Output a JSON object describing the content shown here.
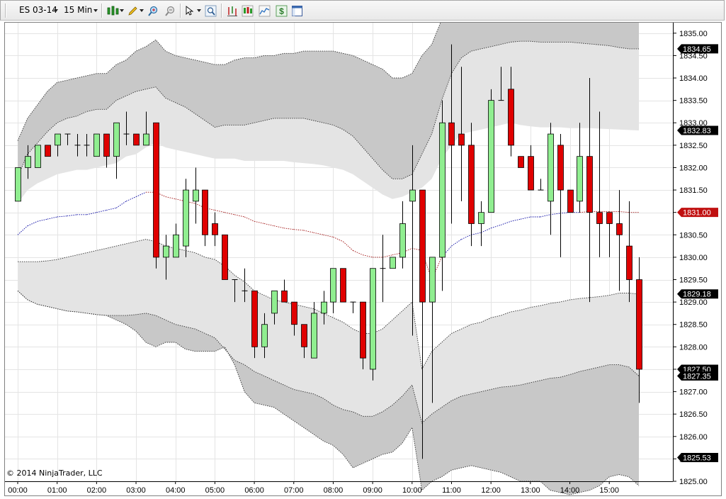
{
  "toolbar": {
    "instrument": "ES 03-14",
    "interval": "15 Min",
    "icons": [
      "chart-style-icon",
      "drawing-pencil-icon",
      "zoom-in-icon",
      "zoom-out-icon",
      "cursor-select-icon",
      "magnifier-icon",
      "bar-chart-icon",
      "candlestick-icon",
      "area-chart-icon",
      "dollar-icon",
      "window-icon"
    ]
  },
  "copyright": "© 2014 NinjaTrader, LLC",
  "colors": {
    "up": "#90ee90",
    "down": "#e00000",
    "outer_band": "#c8c8c8",
    "inner_band": "#e4e4e4",
    "upper_mid_line": "#0000a0",
    "lower_mid_line": "#a01010",
    "grid": "#e4e4e4"
  },
  "chart_data": {
    "type": "candlestick",
    "title": "",
    "xlabel": "",
    "ylabel": "",
    "ylim": [
      1825.0,
      1835.25
    ],
    "y_ticks": [
      "1825.00",
      "1825.50",
      "1826.00",
      "1826.50",
      "1827.00",
      "1827.50",
      "1828.00",
      "1828.50",
      "1829.00",
      "1829.50",
      "1830.00",
      "1830.50",
      "1831.00",
      "1831.50",
      "1832.00",
      "1832.50",
      "1833.00",
      "1833.50",
      "1834.00",
      "1834.50",
      "1835.00"
    ],
    "x_tick_labels": [
      "00:00",
      "01:00",
      "02:00",
      "03:00",
      "04:00",
      "05:00",
      "06:00",
      "07:00",
      "08:00",
      "09:00",
      "10:00",
      "11:00",
      "12:00",
      "13:00",
      "14:00",
      "15:00"
    ],
    "price_markers": [
      {
        "label": "1834.65",
        "value": 1834.65,
        "style": "dark"
      },
      {
        "label": "1832.83",
        "value": 1832.83,
        "style": "dark"
      },
      {
        "label": "1831.00",
        "value": 1831.0,
        "style": "red"
      },
      {
        "label": "1829.18",
        "value": 1829.18,
        "style": "dark"
      },
      {
        "label": "1827.50",
        "value": 1827.5,
        "style": "dark"
      },
      {
        "label": "1827.35",
        "value": 1827.35,
        "style": "dark"
      },
      {
        "label": "1825.53",
        "value": 1825.53,
        "style": "dark"
      }
    ],
    "candles": [
      {
        "o": 1831.25,
        "h": 1832.0,
        "l": 1831.25,
        "c": 1832.0
      },
      {
        "o": 1832.0,
        "h": 1832.5,
        "l": 1831.75,
        "c": 1832.25
      },
      {
        "o": 1832.0,
        "h": 1832.5,
        "l": 1832.0,
        "c": 1832.5
      },
      {
        "o": 1832.5,
        "h": 1832.5,
        "l": 1832.25,
        "c": 1832.25
      },
      {
        "o": 1832.5,
        "h": 1832.75,
        "l": 1832.25,
        "c": 1832.75
      },
      {
        "o": 1832.75,
        "h": 1832.75,
        "l": 1832.5,
        "c": 1832.75
      },
      {
        "o": 1832.5,
        "h": 1832.75,
        "l": 1832.25,
        "c": 1832.5
      },
      {
        "o": 1832.5,
        "h": 1832.75,
        "l": 1832.25,
        "c": 1832.5
      },
      {
        "o": 1832.25,
        "h": 1832.75,
        "l": 1832.25,
        "c": 1832.75
      },
      {
        "o": 1832.75,
        "h": 1832.75,
        "l": 1832.0,
        "c": 1832.25
      },
      {
        "o": 1832.25,
        "h": 1833.0,
        "l": 1831.75,
        "c": 1833.0
      },
      {
        "o": 1832.75,
        "h": 1833.25,
        "l": 1832.5,
        "c": 1832.75
      },
      {
        "o": 1832.75,
        "h": 1832.75,
        "l": 1832.5,
        "c": 1832.5
      },
      {
        "o": 1832.5,
        "h": 1833.25,
        "l": 1832.5,
        "c": 1832.75
      },
      {
        "o": 1833.0,
        "h": 1833.0,
        "l": 1829.75,
        "c": 1830.0
      },
      {
        "o": 1830.0,
        "h": 1830.5,
        "l": 1829.5,
        "c": 1830.25
      },
      {
        "o": 1830.0,
        "h": 1830.75,
        "l": 1830.0,
        "c": 1830.5
      },
      {
        "o": 1830.25,
        "h": 1831.75,
        "l": 1830.0,
        "c": 1831.5
      },
      {
        "o": 1831.25,
        "h": 1832.0,
        "l": 1830.75,
        "c": 1831.5
      },
      {
        "o": 1831.5,
        "h": 1831.5,
        "l": 1830.25,
        "c": 1830.5
      },
      {
        "o": 1830.75,
        "h": 1831.0,
        "l": 1830.25,
        "c": 1830.5
      },
      {
        "o": 1830.5,
        "h": 1830.5,
        "l": 1829.5,
        "c": 1829.5
      },
      {
        "o": 1829.5,
        "h": 1829.5,
        "l": 1829.0,
        "c": 1829.5
      },
      {
        "o": 1829.25,
        "h": 1829.75,
        "l": 1829.0,
        "c": 1829.25
      },
      {
        "o": 1829.25,
        "h": 1829.25,
        "l": 1827.75,
        "c": 1828.0
      },
      {
        "o": 1828.0,
        "h": 1828.75,
        "l": 1827.75,
        "c": 1828.5
      },
      {
        "o": 1828.75,
        "h": 1829.25,
        "l": 1828.5,
        "c": 1829.25
      },
      {
        "o": 1829.25,
        "h": 1829.5,
        "l": 1829.0,
        "c": 1829.0
      },
      {
        "o": 1829.0,
        "h": 1829.0,
        "l": 1828.25,
        "c": 1828.5
      },
      {
        "o": 1828.5,
        "h": 1828.5,
        "l": 1827.75,
        "c": 1828.0
      },
      {
        "o": 1827.75,
        "h": 1829.0,
        "l": 1827.75,
        "c": 1828.75
      },
      {
        "o": 1828.75,
        "h": 1829.25,
        "l": 1828.5,
        "c": 1829.0
      },
      {
        "o": 1829.0,
        "h": 1829.75,
        "l": 1828.75,
        "c": 1829.75
      },
      {
        "o": 1829.75,
        "h": 1829.75,
        "l": 1829.0,
        "c": 1829.0
      },
      {
        "o": 1829.0,
        "h": 1829.0,
        "l": 1828.75,
        "c": 1829.0
      },
      {
        "o": 1829.0,
        "h": 1829.0,
        "l": 1827.5,
        "c": 1827.75
      },
      {
        "o": 1827.5,
        "h": 1829.75,
        "l": 1827.25,
        "c": 1829.75
      },
      {
        "o": 1829.75,
        "h": 1830.5,
        "l": 1829.0,
        "c": 1829.75
      },
      {
        "o": 1829.75,
        "h": 1830.0,
        "l": 1829.75,
        "c": 1830.0
      },
      {
        "o": 1830.0,
        "h": 1831.25,
        "l": 1829.75,
        "c": 1830.75
      },
      {
        "o": 1831.25,
        "h": 1832.5,
        "l": 1828.25,
        "c": 1831.5
      },
      {
        "o": 1831.5,
        "h": 1831.5,
        "l": 1825.5,
        "c": 1829.0
      },
      {
        "o": 1829.0,
        "h": 1830.0,
        "l": 1826.75,
        "c": 1830.0
      },
      {
        "o": 1830.0,
        "h": 1833.5,
        "l": 1829.25,
        "c": 1833.0
      },
      {
        "o": 1833.0,
        "h": 1834.75,
        "l": 1830.75,
        "c": 1832.5
      },
      {
        "o": 1832.75,
        "h": 1834.25,
        "l": 1831.25,
        "c": 1832.5
      },
      {
        "o": 1832.5,
        "h": 1833.0,
        "l": 1830.25,
        "c": 1830.75
      },
      {
        "o": 1830.75,
        "h": 1831.25,
        "l": 1830.25,
        "c": 1831.0
      },
      {
        "o": 1831.0,
        "h": 1833.75,
        "l": 1831.0,
        "c": 1833.5
      },
      {
        "o": 1833.5,
        "h": 1834.25,
        "l": 1833.5,
        "c": 1833.5
      },
      {
        "o": 1833.75,
        "h": 1834.25,
        "l": 1832.25,
        "c": 1832.5
      },
      {
        "o": 1832.25,
        "h": 1832.25,
        "l": 1832.0,
        "c": 1832.0
      },
      {
        "o": 1832.25,
        "h": 1832.5,
        "l": 1831.5,
        "c": 1831.5
      },
      {
        "o": 1831.5,
        "h": 1831.75,
        "l": 1831.5,
        "c": 1831.5
      },
      {
        "o": 1831.25,
        "h": 1833.0,
        "l": 1830.5,
        "c": 1832.75
      },
      {
        "o": 1832.5,
        "h": 1832.75,
        "l": 1830.0,
        "c": 1831.5
      },
      {
        "o": 1831.5,
        "h": 1831.5,
        "l": 1831.0,
        "c": 1831.0
      },
      {
        "o": 1831.25,
        "h": 1833.0,
        "l": 1831.0,
        "c": 1832.25
      },
      {
        "o": 1832.25,
        "h": 1834.0,
        "l": 1829.0,
        "c": 1831.0
      },
      {
        "o": 1831.0,
        "h": 1833.25,
        "l": 1830.0,
        "c": 1830.75
      },
      {
        "o": 1831.0,
        "h": 1831.0,
        "l": 1830.0,
        "c": 1830.75
      },
      {
        "o": 1830.75,
        "h": 1831.5,
        "l": 1829.25,
        "c": 1830.5
      },
      {
        "o": 1830.25,
        "h": 1831.25,
        "l": 1829.0,
        "c": 1829.5
      },
      {
        "o": 1829.5,
        "h": 1830.0,
        "l": 1826.75,
        "c": 1827.5
      }
    ],
    "bands": {
      "outer_upper": [
        1832.6,
        1833.1,
        1833.4,
        1833.7,
        1833.9,
        1833.95,
        1834.0,
        1834.05,
        1834.1,
        1834.1,
        1834.3,
        1834.4,
        1834.6,
        1834.7,
        1834.85,
        1834.6,
        1834.5,
        1834.45,
        1834.4,
        1834.35,
        1834.3,
        1834.3,
        1834.4,
        1834.45,
        1834.45,
        1834.5,
        1834.5,
        1834.55,
        1834.55,
        1834.6,
        1834.6,
        1834.6,
        1834.6,
        1834.55,
        1834.5,
        1834.4,
        1834.3,
        1834.2,
        1834.0,
        1834.0,
        1834.1,
        1834.5,
        1834.75,
        1835.3,
        1835.25,
        1835.25,
        1835.25,
        1835.25,
        1835.25,
        1835.25,
        1835.25,
        1835.25,
        1835.25,
        1835.25,
        1835.25,
        1835.25,
        1835.25,
        1835.25,
        1835.25,
        1835.25,
        1835.25,
        1835.25,
        1835.25,
        1835.25
      ],
      "inner_upper": [
        1831.8,
        1832.3,
        1832.55,
        1832.8,
        1833.0,
        1833.1,
        1833.15,
        1833.25,
        1833.3,
        1833.3,
        1833.5,
        1833.6,
        1833.7,
        1833.75,
        1833.8,
        1833.55,
        1833.45,
        1833.35,
        1833.2,
        1833.05,
        1832.9,
        1832.95,
        1832.95,
        1832.95,
        1833.0,
        1833.05,
        1833.1,
        1833.1,
        1833.1,
        1833.1,
        1833.05,
        1833.0,
        1832.95,
        1832.85,
        1832.7,
        1832.45,
        1832.2,
        1831.95,
        1831.75,
        1831.75,
        1831.85,
        1832.3,
        1832.75,
        1833.5,
        1834.1,
        1834.45,
        1834.6,
        1834.65,
        1834.7,
        1834.75,
        1834.8,
        1834.82,
        1834.82,
        1834.8,
        1834.8,
        1834.8,
        1834.8,
        1834.78,
        1834.76,
        1834.74,
        1834.72,
        1834.68,
        1834.65,
        1834.65
      ],
      "upper_mid": [
        1831.2,
        1831.5,
        1831.65,
        1831.75,
        1831.85,
        1831.9,
        1831.95,
        1831.95,
        1832.0,
        1832.05,
        1832.1,
        1832.25,
        1832.3,
        1832.45,
        1832.55,
        1832.45,
        1832.4,
        1832.35,
        1832.3,
        1832.25,
        1832.2,
        1832.2,
        1832.2,
        1832.15,
        1832.15,
        1832.15,
        1832.15,
        1832.15,
        1832.12,
        1832.1,
        1832.08,
        1832.05,
        1832.0,
        1831.95,
        1831.85,
        1831.7,
        1831.55,
        1831.4,
        1831.3,
        1831.35,
        1831.45,
        1831.55,
        1831.75,
        1832.2,
        1832.5,
        1832.75,
        1832.8,
        1832.85,
        1832.9,
        1832.95,
        1833.0,
        1832.95,
        1832.92,
        1832.9,
        1832.9,
        1832.9,
        1832.88,
        1832.88,
        1832.88,
        1832.87,
        1832.86,
        1832.85,
        1832.84,
        1832.83
      ],
      "mid": [
        1830.5,
        1830.7,
        1830.8,
        1830.85,
        1830.9,
        1830.92,
        1830.95,
        1830.95,
        1831.0,
        1831.05,
        1831.1,
        1831.25,
        1831.35,
        1831.45,
        1831.45,
        1831.35,
        1831.3,
        1831.25,
        1831.2,
        1831.1,
        1831.05,
        1831.0,
        1830.95,
        1830.9,
        1830.8,
        1830.75,
        1830.7,
        1830.65,
        1830.62,
        1830.6,
        1830.55,
        1830.5,
        1830.45,
        1830.35,
        1830.15,
        1830.05,
        1830.0,
        1830.0,
        1830.05,
        1830.1,
        1830.2,
        1830.15,
        1829.5,
        1830.0,
        1830.25,
        1830.4,
        1830.5,
        1830.55,
        1830.65,
        1830.72,
        1830.8,
        1830.85,
        1830.9,
        1830.9,
        1830.95,
        1830.98,
        1831.0,
        1831.0,
        1831.02,
        1831.02,
        1831.02,
        1831.02,
        1831.0,
        1831.0
      ],
      "lower_mid": [
        1829.9,
        1829.9,
        1829.9,
        1829.92,
        1829.95,
        1830.0,
        1830.05,
        1830.1,
        1830.15,
        1830.2,
        1830.25,
        1830.3,
        1830.35,
        1830.4,
        1830.35,
        1830.25,
        1830.2,
        1830.15,
        1830.1,
        1830.0,
        1829.95,
        1829.8,
        1829.6,
        1829.45,
        1829.25,
        1829.15,
        1829.05,
        1829.0,
        1828.95,
        1828.9,
        1828.85,
        1828.75,
        1828.65,
        1828.55,
        1828.4,
        1828.3,
        1828.3,
        1828.4,
        1828.6,
        1828.8,
        1829.0,
        1827.5,
        1827.9,
        1828.1,
        1828.3,
        1828.4,
        1828.5,
        1828.55,
        1828.65,
        1828.7,
        1828.78,
        1828.82,
        1828.88,
        1828.92,
        1828.97,
        1829.0,
        1829.05,
        1829.08,
        1829.1,
        1829.12,
        1829.15,
        1829.2,
        1829.2,
        1829.18
      ],
      "inner_lower": [
        1829.25,
        1829.05,
        1828.95,
        1828.9,
        1828.85,
        1828.8,
        1828.78,
        1828.75,
        1828.72,
        1828.7,
        1828.7,
        1828.7,
        1828.72,
        1828.75,
        1828.7,
        1828.6,
        1828.5,
        1828.45,
        1828.4,
        1828.3,
        1828.2,
        1827.95,
        1827.7,
        1827.6,
        1827.45,
        1827.35,
        1827.25,
        1827.15,
        1827.05,
        1827.0,
        1826.95,
        1826.85,
        1826.7,
        1826.6,
        1826.55,
        1826.45,
        1826.45,
        1826.55,
        1826.7,
        1826.9,
        1827.15,
        1826.3,
        1826.5,
        1826.65,
        1826.8,
        1826.9,
        1826.95,
        1827.0,
        1827.05,
        1827.1,
        1827.12,
        1827.15,
        1827.2,
        1827.25,
        1827.3,
        1827.32,
        1827.38,
        1827.45,
        1827.5,
        1827.55,
        1827.6,
        1827.6,
        1827.55,
        1827.35
      ],
      "outer_lower": [
        1829.25,
        1829.05,
        1828.95,
        1828.9,
        1828.85,
        1828.8,
        1828.78,
        1828.75,
        1828.72,
        1828.7,
        1828.6,
        1828.5,
        1828.35,
        1828.1,
        1828.0,
        1828.1,
        1828.1,
        1827.95,
        1827.9,
        1827.9,
        1827.9,
        1828.0,
        1827.6,
        1827.0,
        1826.75,
        1826.7,
        1826.65,
        1826.5,
        1826.35,
        1826.2,
        1826.05,
        1825.9,
        1825.8,
        1825.6,
        1825.3,
        1825.4,
        1825.5,
        1825.6,
        1825.65,
        1825.85,
        1826.2,
        1824.8,
        1825.0,
        1825.1,
        1825.25,
        1825.3,
        1825.35,
        1825.3,
        1825.25,
        1825.2,
        1825.1,
        1825.0,
        1825.0,
        1825.0,
        1824.8,
        1824.75,
        1824.7,
        1824.75,
        1824.8,
        1824.9,
        1825.1,
        1825.15,
        1825.1,
        1824.9
      ]
    }
  }
}
